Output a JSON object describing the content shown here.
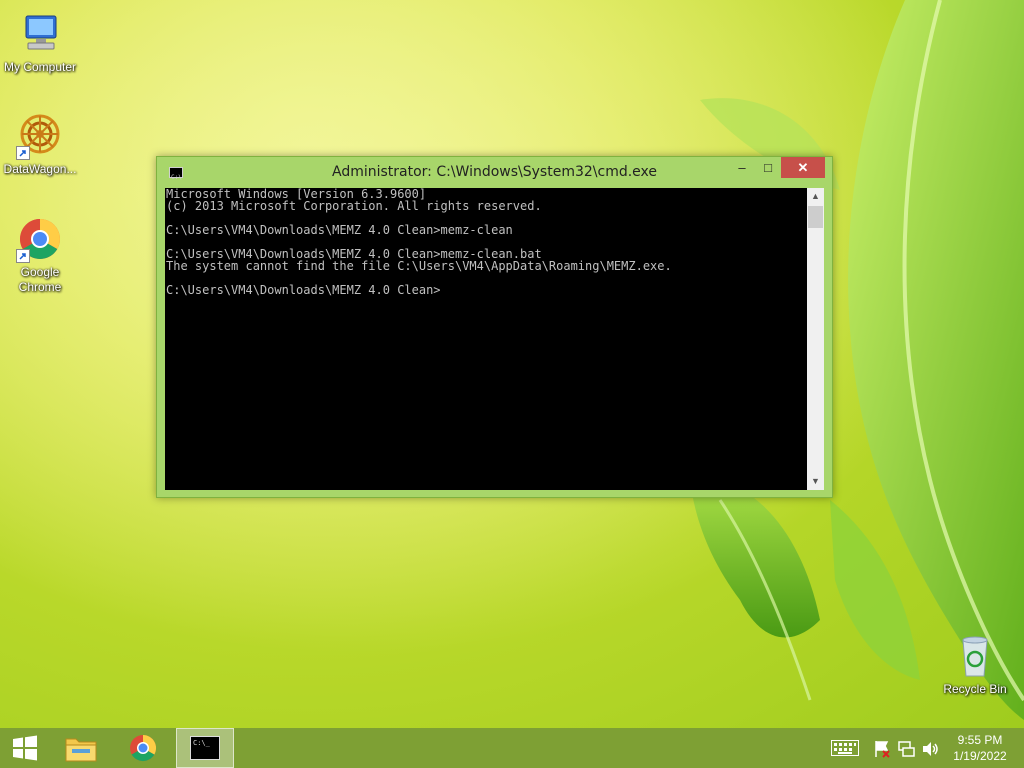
{
  "desktop": {
    "icons": [
      {
        "label": "My Computer"
      },
      {
        "label": "DataWagon..."
      },
      {
        "label": "Google Chrome"
      },
      {
        "label": "Recycle Bin"
      }
    ]
  },
  "window": {
    "title": "Administrator: C:\\Windows\\System32\\cmd.exe",
    "minimize": "–",
    "maximize": "□",
    "close": "✕",
    "console_lines": [
      "Microsoft Windows [Version 6.3.9600]",
      "(c) 2013 Microsoft Corporation. All rights reserved.",
      "",
      "C:\\Users\\VM4\\Downloads\\MEMZ 4.0 Clean>memz-clean",
      "",
      "C:\\Users\\VM4\\Downloads\\MEMZ 4.0 Clean>memz-clean.bat",
      "The system cannot find the file C:\\Users\\VM4\\AppData\\Roaming\\MEMZ.exe.",
      "",
      "C:\\Users\\VM4\\Downloads\\MEMZ 4.0 Clean>"
    ]
  },
  "taskbar": {
    "time": "9:55 PM",
    "date": "1/19/2022",
    "icons": [
      "windows-start-icon",
      "file-explorer-icon",
      "chrome-icon",
      "cmd-icon",
      "keyboard-icon",
      "action-center-icon",
      "network-icon",
      "volume-icon"
    ]
  },
  "colors": {
    "console_bg": "#000000",
    "console_fg": "#c0c0c0",
    "window_frame": "#a8d66a",
    "close_button": "#c7504a"
  }
}
